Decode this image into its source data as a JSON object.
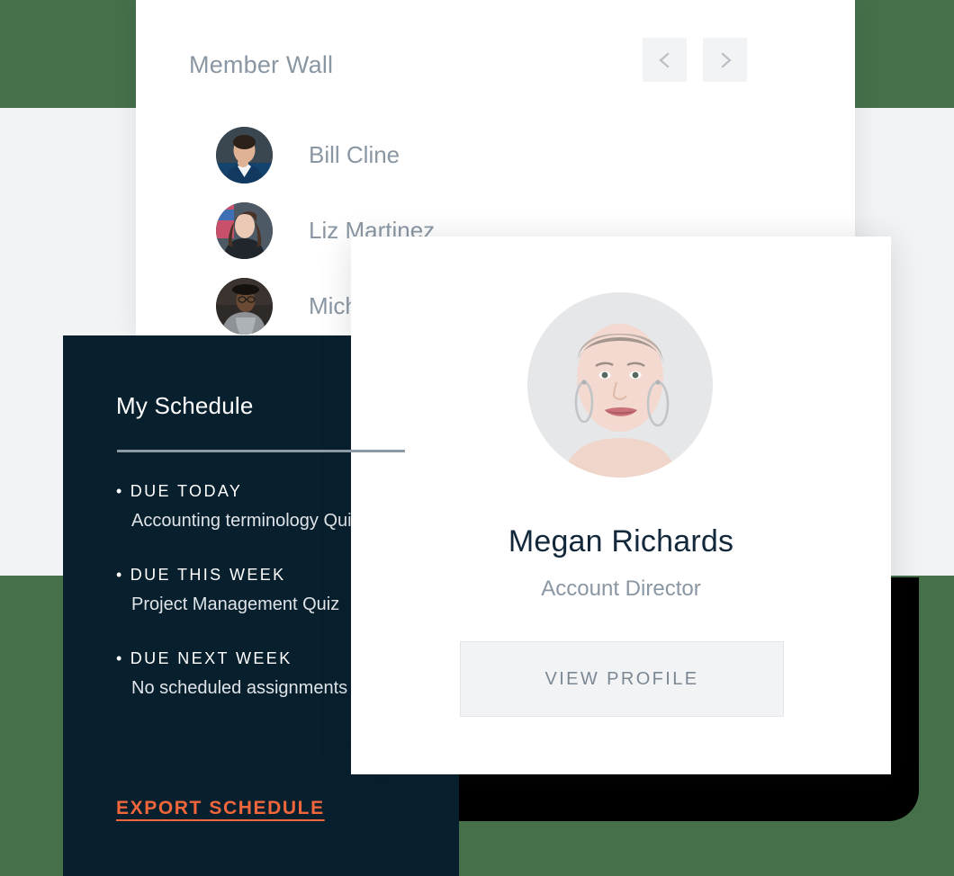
{
  "theme": {
    "background_green": "#46704A",
    "background_gray": "#F2F3F5",
    "panel_dark": "#081F2D",
    "accent_orange": "#F2663C",
    "text_muted": "#8A97A3",
    "text_dark": "#13293B",
    "slab_black": "#000000"
  },
  "member_wall": {
    "title": "Member Wall",
    "prev_label": "Previous members",
    "next_label": "Next members",
    "prev_icon": "chevron-left-icon",
    "next_icon": "chevron-right-icon",
    "members": [
      {
        "name": "Bill Cline",
        "avatar": "portrait-man-suit"
      },
      {
        "name": "Liz Martinez",
        "avatar": "portrait-woman-dark-hair"
      },
      {
        "name": "Mich",
        "avatar": "portrait-man-hat"
      }
    ]
  },
  "schedule": {
    "title": "My Schedule",
    "groups": [
      {
        "bullet": "•",
        "label": "DUE TODAY",
        "value": "Accounting terminology Quiz"
      },
      {
        "bullet": "•",
        "label": "DUE THIS WEEK",
        "value": "Project Management Quiz"
      },
      {
        "bullet": "•",
        "label": "DUE NEXT WEEK",
        "value": "No scheduled assignments"
      }
    ],
    "export_label": "EXPORT SCHEDULE"
  },
  "profile_card": {
    "photo_alt": "portrait-woman-short-hair-earrings",
    "name": "Megan Richards",
    "role": "Account Director",
    "button_label": "VIEW PROFILE"
  }
}
